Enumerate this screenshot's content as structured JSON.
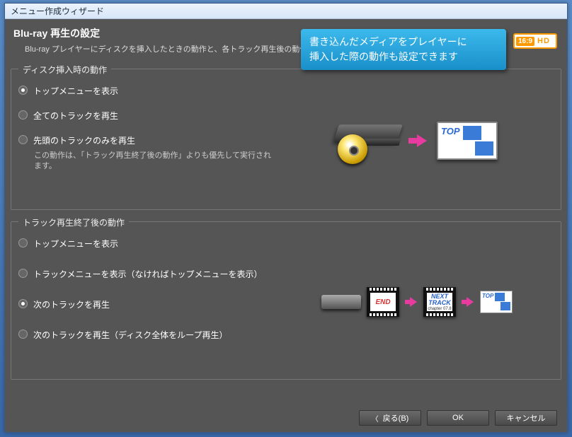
{
  "window_title": "メニュー作成ウィザード",
  "header": {
    "title": "Blu-ray 再生の設定",
    "subtitle": "Blu-ray プレイヤーにディスクを挿入したときの動作と、各トラック再生後の動作を指定します"
  },
  "callout": {
    "line1": "書き込んだメディアをプレイヤーに",
    "line2": "挿入した際の動作も設定できます"
  },
  "hd_badge": {
    "ratio": "16:9",
    "hd": "HD"
  },
  "group1": {
    "title": "ディスク挿入時の動作",
    "options": [
      {
        "label": "トップメニューを表示",
        "selected": true
      },
      {
        "label": "全てのトラックを再生",
        "selected": false
      },
      {
        "label": "先頭のトラックのみを再生",
        "selected": false,
        "note": "この動作は、「トラック再生終了後の動作」よりも優先して実行されます。"
      }
    ],
    "illus": {
      "tv_label": "TOP"
    }
  },
  "group2": {
    "title": "トラック再生終了後の動作",
    "options": [
      {
        "label": "トップメニューを表示",
        "selected": false
      },
      {
        "label": "トラックメニューを表示（なければトップメニューを表示）",
        "selected": false
      },
      {
        "label": "次のトラックを再生",
        "selected": true
      },
      {
        "label": "次のトラックを再生（ディスク全体をループ再生）",
        "selected": false
      }
    ],
    "illus": {
      "film_end": "END",
      "film_next_l1": "NEXT",
      "film_next_l2": "TRACK",
      "film_next_sub": "chapter 07.8",
      "tv_label": "TOP"
    }
  },
  "footer": {
    "back": "戻る(B)",
    "ok": "OK",
    "cancel": "キャンセル"
  }
}
